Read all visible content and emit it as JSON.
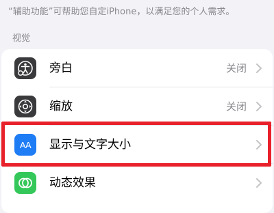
{
  "description": "“辅助功能”可帮助您自定iPhone，以满足您的个人需求。",
  "section": {
    "header": "视觉"
  },
  "rows": [
    {
      "label": "旁白",
      "value": "关闭",
      "icon": "voiceover-icon",
      "icon_color": "#3a3a3c"
    },
    {
      "label": "缩放",
      "value": "关闭",
      "icon": "zoom-icon",
      "icon_color": "#3a3a3c"
    },
    {
      "label": "显示与文字大小",
      "value": "",
      "icon": "display-text-size-icon",
      "icon_color": "#1e7cf5",
      "icon_text": "AA"
    },
    {
      "label": "动态效果",
      "value": "",
      "icon": "motion-icon",
      "icon_color": "#34c759"
    }
  ],
  "highlight": {
    "color": "#e8202a"
  }
}
